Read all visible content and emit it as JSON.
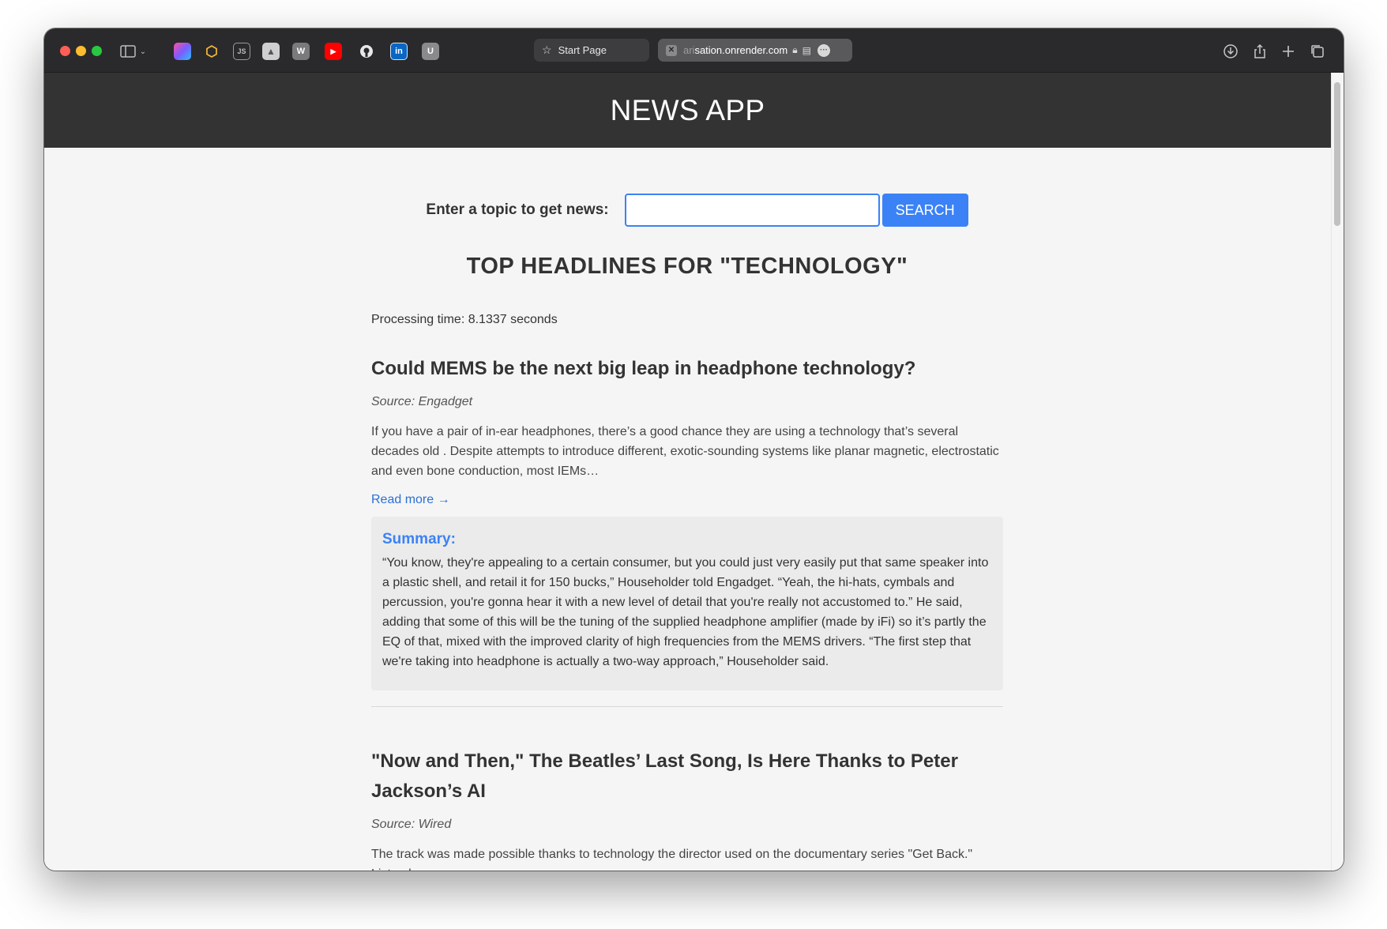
{
  "browser": {
    "tabs": [
      {
        "label": "Start Page"
      },
      {
        "url_faded": "ari",
        "url": "sation.onrender.com"
      }
    ]
  },
  "app": {
    "title": "NEWS APP"
  },
  "search": {
    "label": "Enter a topic to get news:",
    "value": "",
    "button": "SEARCH"
  },
  "results": {
    "heading": "TOP HEADLINES FOR \"TECHNOLOGY\"",
    "processing_time": "Processing time: 8.1337 seconds",
    "articles": [
      {
        "title": "Could MEMS be the next big leap in headphone technology?",
        "source": "Source: Engadget",
        "description": "If you have a pair of in-ear headphones, there’s a good chance they are using a technology that’s several decades old . Despite attempts to introduce different, exotic-sounding systems like planar magnetic, electrostatic and even bone conduction, most IEMs…",
        "read_more": "Read more →",
        "summary_label": "Summary:",
        "summary": "“You know, they're appealing to a certain consumer, but you could just very easily put that same speaker into a plastic shell, and retail it for 150 bucks,” Householder told Engadget. “Yeah, the hi-hats, cymbals and percussion, you're gonna hear it with a new level of detail that you're really not accustomed to.” He said, adding that some of this will be the tuning of the supplied headphone amplifier (made by iFi) so it’s partly the EQ of that, mixed with the improved clarity of high frequencies from the MEMS drivers. “The first step that we're taking into headphone is actually a two-way approach,” Householder said."
      },
      {
        "title": "\"Now and Then,\" The Beatles’ Last Song, Is Here Thanks to Peter Jackson’s AI",
        "source": "Source: Wired",
        "description": "The track was made possible thanks to technology the director used on the documentary series \"Get Back.\" Listen here."
      }
    ]
  }
}
